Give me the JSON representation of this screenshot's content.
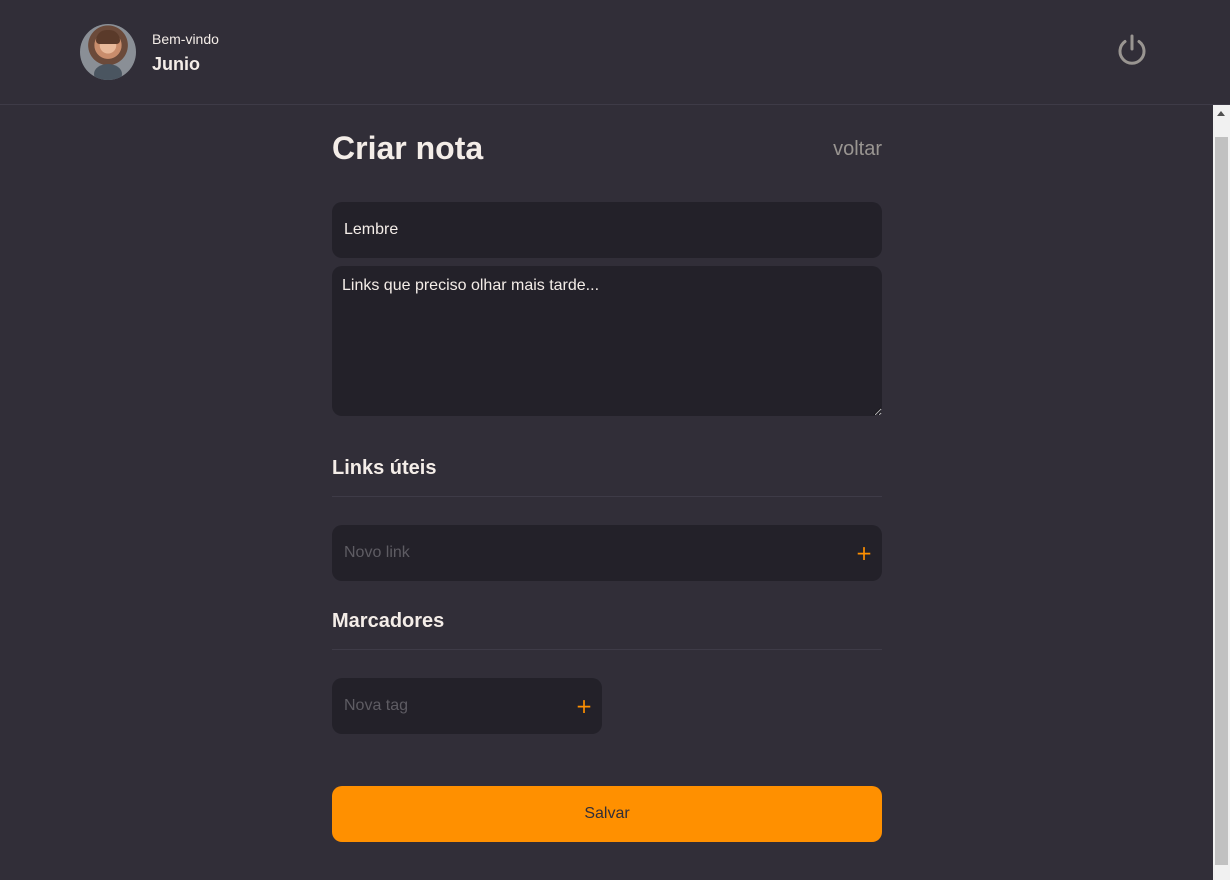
{
  "header": {
    "welcome_label": "Bem-vindo",
    "user_name": "Junio"
  },
  "page": {
    "title": "Criar nota",
    "back_label": "voltar"
  },
  "form": {
    "title_value": "Lembre",
    "description_value": "Links que preciso olhar mais tarde...",
    "links_section_title": "Links úteis",
    "link_placeholder": "Novo link",
    "tags_section_title": "Marcadores",
    "tag_placeholder": "Nova tag",
    "add_symbol": "+",
    "save_label": "Salvar"
  },
  "icons": {
    "avatar": "avatar-photo",
    "logout": "power-icon",
    "add": "plus-icon"
  },
  "colors": {
    "background": "#312E38",
    "input_background": "#232129",
    "accent": "#FF9000",
    "text": "#F4EDE8",
    "muted": "#999591"
  }
}
